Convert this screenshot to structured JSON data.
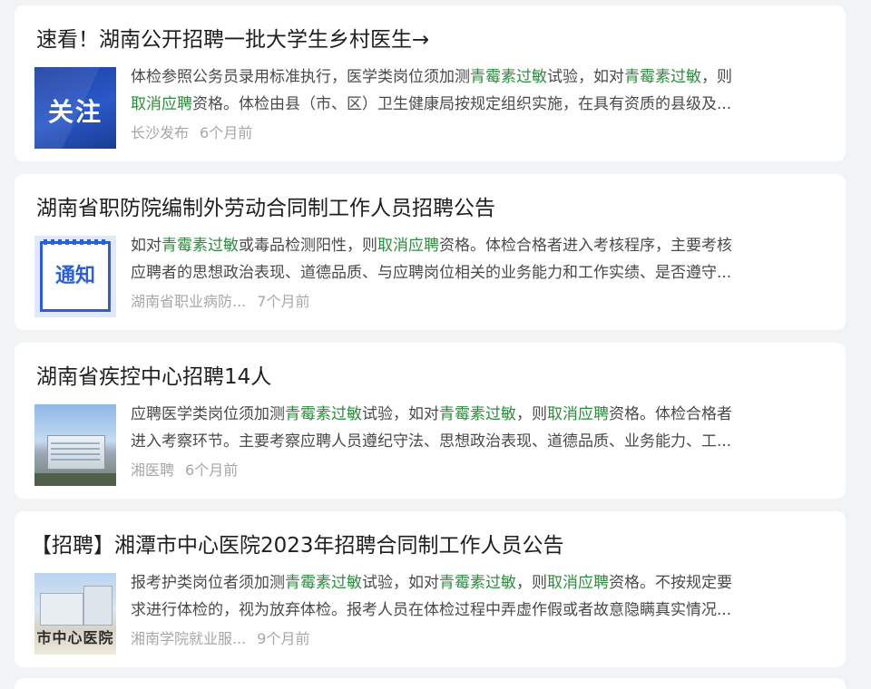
{
  "articles": [
    {
      "title": "速看！湖南公开招聘一批大学生乡村医生→",
      "thumb_text": "关注",
      "line1": [
        {
          "t": "体检参照公务员录用标准执行，医学类岗位须加测"
        },
        {
          "t": "青霉素过敏",
          "hl": true
        },
        {
          "t": "试验，如对"
        },
        {
          "t": "青霉素过敏",
          "hl": true
        },
        {
          "t": "，则"
        }
      ],
      "line2": [
        {
          "t": "取消应聘",
          "hl": true
        },
        {
          "t": "资格。体检由县（市、区）卫生健康局按规定组织实施，在具有资质的县级及..."
        }
      ],
      "source": "长沙发布",
      "time": "6个月前"
    },
    {
      "title": "湖南省职防院编制外劳动合同制工作人员招聘公告",
      "thumb_text": "通知",
      "line1": [
        {
          "t": "如对"
        },
        {
          "t": "青霉素过敏",
          "hl": true
        },
        {
          "t": "或毒品检测阳性，则"
        },
        {
          "t": "取消应聘",
          "hl": true
        },
        {
          "t": "资格。体检合格者进入考核程序，主要考核"
        }
      ],
      "line2": [
        {
          "t": "应聘者的思想政治表现、道德品质、与应聘岗位相关的业务能力和工作实绩、是否遵守..."
        }
      ],
      "source": "湖南省职业病防...",
      "time": "7个月前"
    },
    {
      "title": "湖南省疾控中心招聘14人",
      "thumb_text": "",
      "line1": [
        {
          "t": "应聘医学类岗位须加测"
        },
        {
          "t": "青霉素过敏",
          "hl": true
        },
        {
          "t": "试验，如对"
        },
        {
          "t": "青霉素过敏",
          "hl": true
        },
        {
          "t": "，则"
        },
        {
          "t": "取消应聘",
          "hl": true
        },
        {
          "t": "资格。体检合格者"
        }
      ],
      "line2": [
        {
          "t": "进入考察环节。主要考察应聘人员遵纪守法、思想政治表现、道德品质、业务能力、工..."
        }
      ],
      "source": "湘医聘",
      "time": "6个月前"
    },
    {
      "title": "【招聘】湘潭市中心医院2023年招聘合同制工作人员公告",
      "thumb_text": "市中心医院",
      "line1": [
        {
          "t": "报考护类岗位者须加测"
        },
        {
          "t": "青霉素过敏",
          "hl": true
        },
        {
          "t": "试验，如对"
        },
        {
          "t": "青霉素过敏",
          "hl": true
        },
        {
          "t": "，则"
        },
        {
          "t": "取消应聘",
          "hl": true
        },
        {
          "t": "资格。不按规定要"
        }
      ],
      "line2": [
        {
          "t": "求进行体检的，视为放弃体检。报考人员在体检过程中弄虚作假或者故意隐瞒真实情况..."
        }
      ],
      "source": "湘南学院就业服...",
      "time": "9个月前"
    }
  ],
  "colors": {
    "highlight": "#2e8b3e",
    "background": "#f2f3f5",
    "card": "#ffffff",
    "meta": "#a7a7a7"
  }
}
